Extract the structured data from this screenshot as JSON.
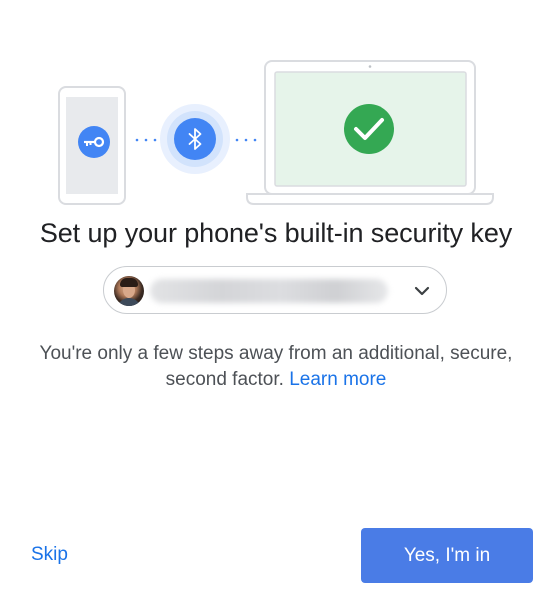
{
  "illustration": {
    "key_icon": "key-icon",
    "bluetooth_icon": "bluetooth-icon",
    "check_icon": "check-icon",
    "colors": {
      "blue": "#4285f4",
      "green": "#34a853",
      "screen_green": "#e6f4ea"
    }
  },
  "title": "Set up your phone's built-in security key",
  "account": {
    "email": "",
    "avatar_icon": "avatar",
    "chevron_icon": "chevron-down-icon"
  },
  "subtitle": {
    "text": "You're only a few steps away from an additional, secure, second factor.",
    "link": "Learn more"
  },
  "actions": {
    "skip_label": "Skip",
    "confirm_label": "Yes, I'm in",
    "confirm_color": "#4a7ce6"
  }
}
